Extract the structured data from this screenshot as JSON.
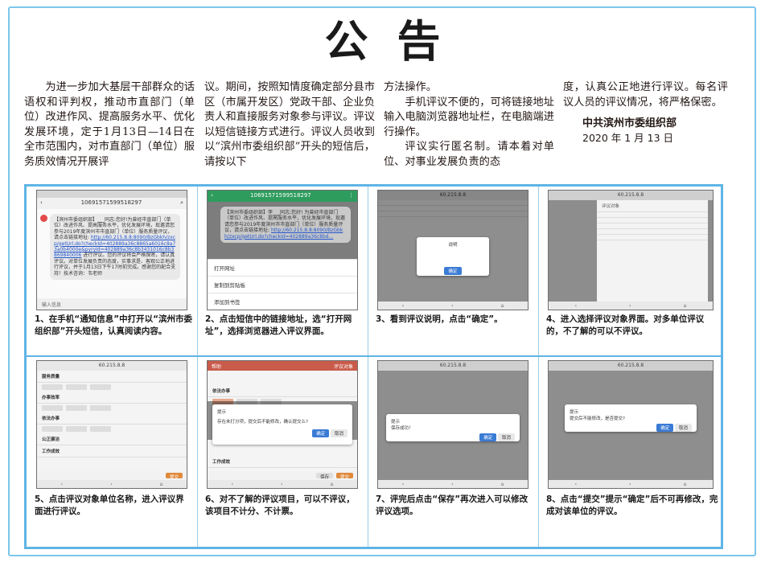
{
  "title": "公告",
  "columns": {
    "col1": "为进一步加大基层干部群众的话语权和评判权，推动市直部门（单位）改进作风、提高服务水平、优化发展环境，定于1月13日—14日在全市范围内，对市直部门（单位）服务质效情况开展评",
    "col2": "议。期间，按照知情度确定部分县市区（市属开发区）党政干部、企业负责人和直接服务对象参与评议。评议以短信链接方式进行。评议人员收到以“滨州市委组织部”开头的短信后，请按以下",
    "col3_p1": "方法操作。",
    "col3_p2": "手机评议不便的，可将链接地址输入电脑浏览器地址栏，在电脑端进行操作。",
    "col3_p3": "评议实行匿名制。请本着对单位、对事业发展负责的态",
    "col4": "度，认真公正地进行评议。每名评议人员的评议情况，将严格保密。",
    "org": "中共滨州市委组织部",
    "date": "2020 年 1 月 13 日"
  },
  "steps": [
    {
      "caption": "1、在手机“通知信息”中打开以“滨州市委组织部”开头短信，认真阅读内容。",
      "phone_number": "10691571599518297",
      "sms": "【滨州市委组织部】___同志:您好!为曾经市直部门（单位）改进作风、提高服务水平，优化发展环境，现邀请您参与2019年度滨州市市直部门（单位）服务质量评议，请点击链接地址:",
      "link": "http://60.215.8.8:8090/BzGbkh/zxcp/getUrl.do?checkId=402889a36c8865a6016c8a73a0b4000e&pyryId=402889a36c8b3431016c8b3869840006",
      "sms_tail": "进行评议。您的评议将会严格保密，请认真评议。对单位发展负责的态度，实事求是、客观公正地进行评议，并于1月13日下午17时前完成。感谢您的配合支持！技术咨询：韦老师",
      "input_placeholder": "输入信息"
    },
    {
      "caption": "2、点击短信中的链接地址，选“打开网址”，选择浏览器进入评议界面。",
      "phone_number": "10691571599518297",
      "sms": "【滨州市委组织部】李___同志:您好!   为曾经市直部门（单位）改进作风、提高服务水平，优化发展环境，现邀请您参与2019年度滨州市市直部门（单位）服务质量评议，请点击链接地址:",
      "link": "http://60.215.8.8:8090/BzGbkh/zxcp/getUrl.do?checkId=402889a36c8bd...",
      "menu": [
        "打开网址",
        "复制到剪贴板",
        "添加到书签"
      ]
    },
    {
      "caption": "3、看到评议说明，点击“确定”。",
      "url": "60.215.8.8",
      "dialog_title": "说明",
      "dialog_button": "确定"
    },
    {
      "caption": "4、进入选择评议对象界面。对多单位评议的，不了解的可以不评议。",
      "url": "60.215.8.8",
      "header": "评议对象"
    },
    {
      "caption": "5、点击评议对象单位名称，进入评议界面进行评议。",
      "url": "60.215.8.8",
      "sections": [
        "服务质量",
        "办事效率",
        "依法办事",
        "公正廉洁",
        "工作成效"
      ],
      "submit": "提交"
    },
    {
      "caption": "6、对不了解的评议项目，可以不评议，该项目不计分、不计票。",
      "header_left": "帮助",
      "header_right": "评议对象",
      "section": "依法办事",
      "section2": "工作成效",
      "dialog_title": "提示",
      "dialog_text": "存在未打分项，提交后不能修改，确认提交么?",
      "ok": "确定",
      "cancel": "取消",
      "save": "保存",
      "submit": "提交"
    },
    {
      "caption": "7、评完后点击“保存”再次进入可以修改评议选项。",
      "url": "60.215.8.8",
      "dialog_title": "提示",
      "dialog_text": "保存成功！",
      "ok": "确定",
      "cancel": "取消"
    },
    {
      "caption": "8、点击“提交”提示“确定”后不可再修改，完成对该单位的评议。",
      "url": "60.215.8.8",
      "dialog_title": "提示",
      "dialog_text": "提交后不能修改，是否提交?",
      "ok": "确定",
      "cancel": "取消"
    }
  ]
}
